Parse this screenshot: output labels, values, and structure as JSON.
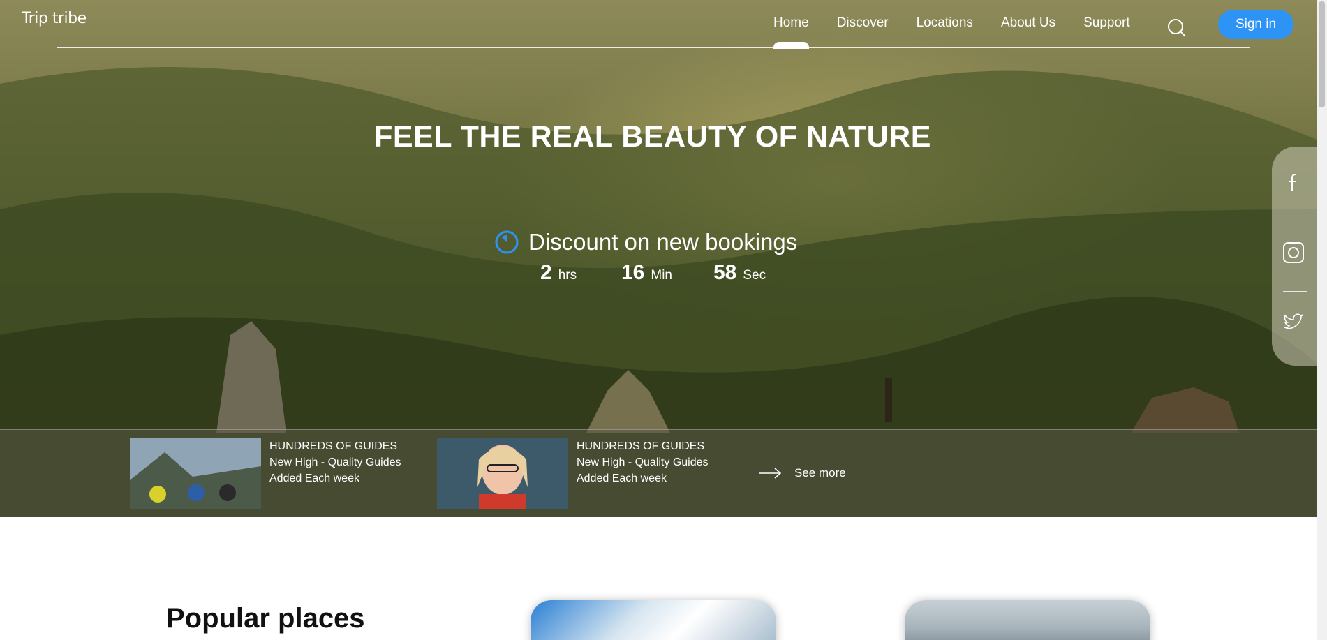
{
  "brand": {
    "logo": "Trip tribe"
  },
  "nav": {
    "items": [
      {
        "label": "Home",
        "active": true
      },
      {
        "label": "Discover"
      },
      {
        "label": "Locations"
      },
      {
        "label": "About Us"
      },
      {
        "label": "Support"
      }
    ],
    "signin_label": "Sign in"
  },
  "hero": {
    "headline": "FEEL THE REAL BEAUTY OF NATURE",
    "discount_label": "Discount on new bookings",
    "timer": [
      {
        "value": "2",
        "unit": "hrs"
      },
      {
        "value": "16",
        "unit": "Min"
      },
      {
        "value": "58",
        "unit": "Sec"
      }
    ]
  },
  "social": [
    "facebook-icon",
    "instagram-icon",
    "twitter-icon"
  ],
  "strip": {
    "cards": [
      {
        "tag": "HUNDREDS OF GUIDES",
        "text": "New High - Quality Guides Added Each week"
      },
      {
        "tag": "HUNDREDS OF GUIDES",
        "text": "New High - Quality Guides Added Each week"
      }
    ],
    "see_more": "See more"
  },
  "popular": {
    "title": "Popular places"
  },
  "colors": {
    "accent": "#2d93f5"
  }
}
